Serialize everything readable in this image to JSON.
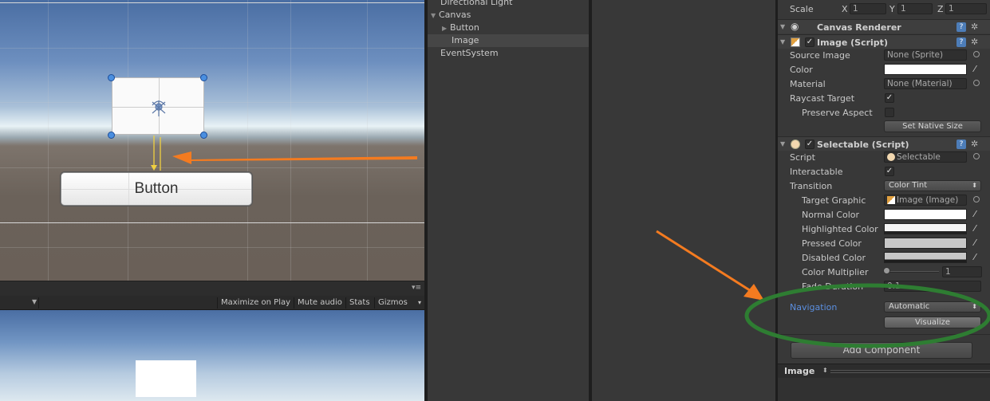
{
  "scene": {
    "button_text": "Button"
  },
  "game_toolbar": {
    "maximize": "Maximize on Play",
    "mute": "Mute audio",
    "stats": "Stats",
    "gizmos": "Gizmos"
  },
  "hierarchy": {
    "items": [
      {
        "label": "Directional Light"
      },
      {
        "label": "Canvas"
      },
      {
        "label": "Button"
      },
      {
        "label": "Image"
      },
      {
        "label": "EventSystem"
      }
    ]
  },
  "inspector": {
    "scale": {
      "label": "Scale",
      "x_label": "X",
      "x": "1",
      "y_label": "Y",
      "y": "1",
      "z_label": "Z",
      "z": "1"
    },
    "canvas_renderer": {
      "title": "Canvas Renderer"
    },
    "image_script": {
      "title": "Image (Script)",
      "source_image_label": "Source Image",
      "source_image_value": "None (Sprite)",
      "color_label": "Color",
      "material_label": "Material",
      "material_value": "None (Material)",
      "raycast_label": "Raycast Target",
      "preserve_label": "Preserve Aspect",
      "set_native_size": "Set Native Size"
    },
    "selectable": {
      "title": "Selectable (Script)",
      "script_label": "Script",
      "script_value": "Selectable",
      "interactable_label": "Interactable",
      "transition_label": "Transition",
      "transition_value": "Color Tint",
      "target_graphic_label": "Target Graphic",
      "target_graphic_value": "Image (Image)",
      "normal_label": "Normal Color",
      "highlighted_label": "Highlighted Color",
      "pressed_label": "Pressed Color",
      "disabled_label": "Disabled Color",
      "multiplier_label": "Color Multiplier",
      "multiplier_value": "1",
      "fade_label": "Fade Duration",
      "fade_value": "0.1",
      "navigation_label": "Navigation",
      "navigation_value": "Automatic",
      "visualize": "Visualize"
    },
    "add_component": "Add Component",
    "preview_title": "Image"
  },
  "colors": {
    "accent_arrow": "#f47b20",
    "highlight_ellipse": "#2e7d32",
    "navigation_label": "#5b8fe0"
  }
}
